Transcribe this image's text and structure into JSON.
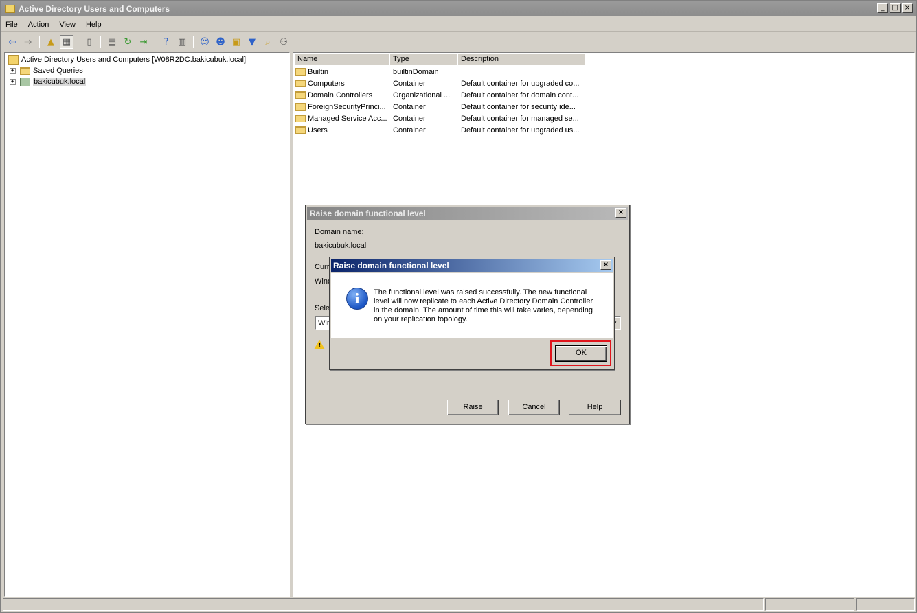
{
  "window": {
    "title": "Active Directory Users and Computers",
    "controls": [
      "_",
      "□",
      "×"
    ]
  },
  "menu": [
    "File",
    "Action",
    "View",
    "Help"
  ],
  "toolbar": {
    "icons": [
      "back-icon",
      "forward-icon",
      "up-level-icon",
      "show-hide-tree-icon",
      "delete-icon",
      "properties-icon",
      "refresh-icon",
      "export-list-icon",
      "help-icon",
      "action-pane-icon",
      "new-user-icon",
      "new-group-icon",
      "new-ou-icon",
      "filter-icon",
      "find-icon",
      "add-to-group-icon"
    ]
  },
  "tree": {
    "root": "Active Directory Users and Computers [W08R2DC.bakicubuk.local]",
    "items": [
      {
        "label": "Saved Queries",
        "expander": "+"
      },
      {
        "label": "bakicubuk.local",
        "expander": "+"
      }
    ]
  },
  "list": {
    "columns": [
      "Name",
      "Type",
      "Description"
    ],
    "rows": [
      {
        "name": "Builtin",
        "type": "builtinDomain",
        "description": ""
      },
      {
        "name": "Computers",
        "type": "Container",
        "description": "Default container for upgraded co..."
      },
      {
        "name": "Domain Controllers",
        "type": "Organizational ...",
        "description": "Default container for domain cont..."
      },
      {
        "name": "ForeignSecurityPrinci...",
        "type": "Container",
        "description": "Default container for security ide..."
      },
      {
        "name": "Managed Service Acc...",
        "type": "Container",
        "description": "Default container for managed se..."
      },
      {
        "name": "Users",
        "type": "Container",
        "description": "Default container for upgraded us..."
      }
    ]
  },
  "raise_dialog": {
    "title": "Raise domain functional level",
    "close": "×",
    "domain_name_label": "Domain name:",
    "domain_name_value": "bakicubuk.local",
    "current_label_partial": "Curre",
    "current_value_partial": "Wind",
    "select_label_partial": "Sele",
    "select_value_partial": "Win",
    "buttons": {
      "raise": "Raise",
      "cancel": "Cancel",
      "help": "Help"
    }
  },
  "message_box": {
    "title": "Raise domain functional level",
    "close": "×",
    "icon": "info-icon",
    "lines": [
      "The functional level was raised successfully. The new functional",
      "level will now replicate to each Active Directory Domain Controller",
      "in the domain. The amount of time this will take varies, depending",
      "on your replication topology."
    ],
    "ok": "OK"
  },
  "colors": {
    "active_title_start": "#0b246a",
    "active_title_end": "#a6caf0",
    "highlight_border": "#e0141b"
  }
}
